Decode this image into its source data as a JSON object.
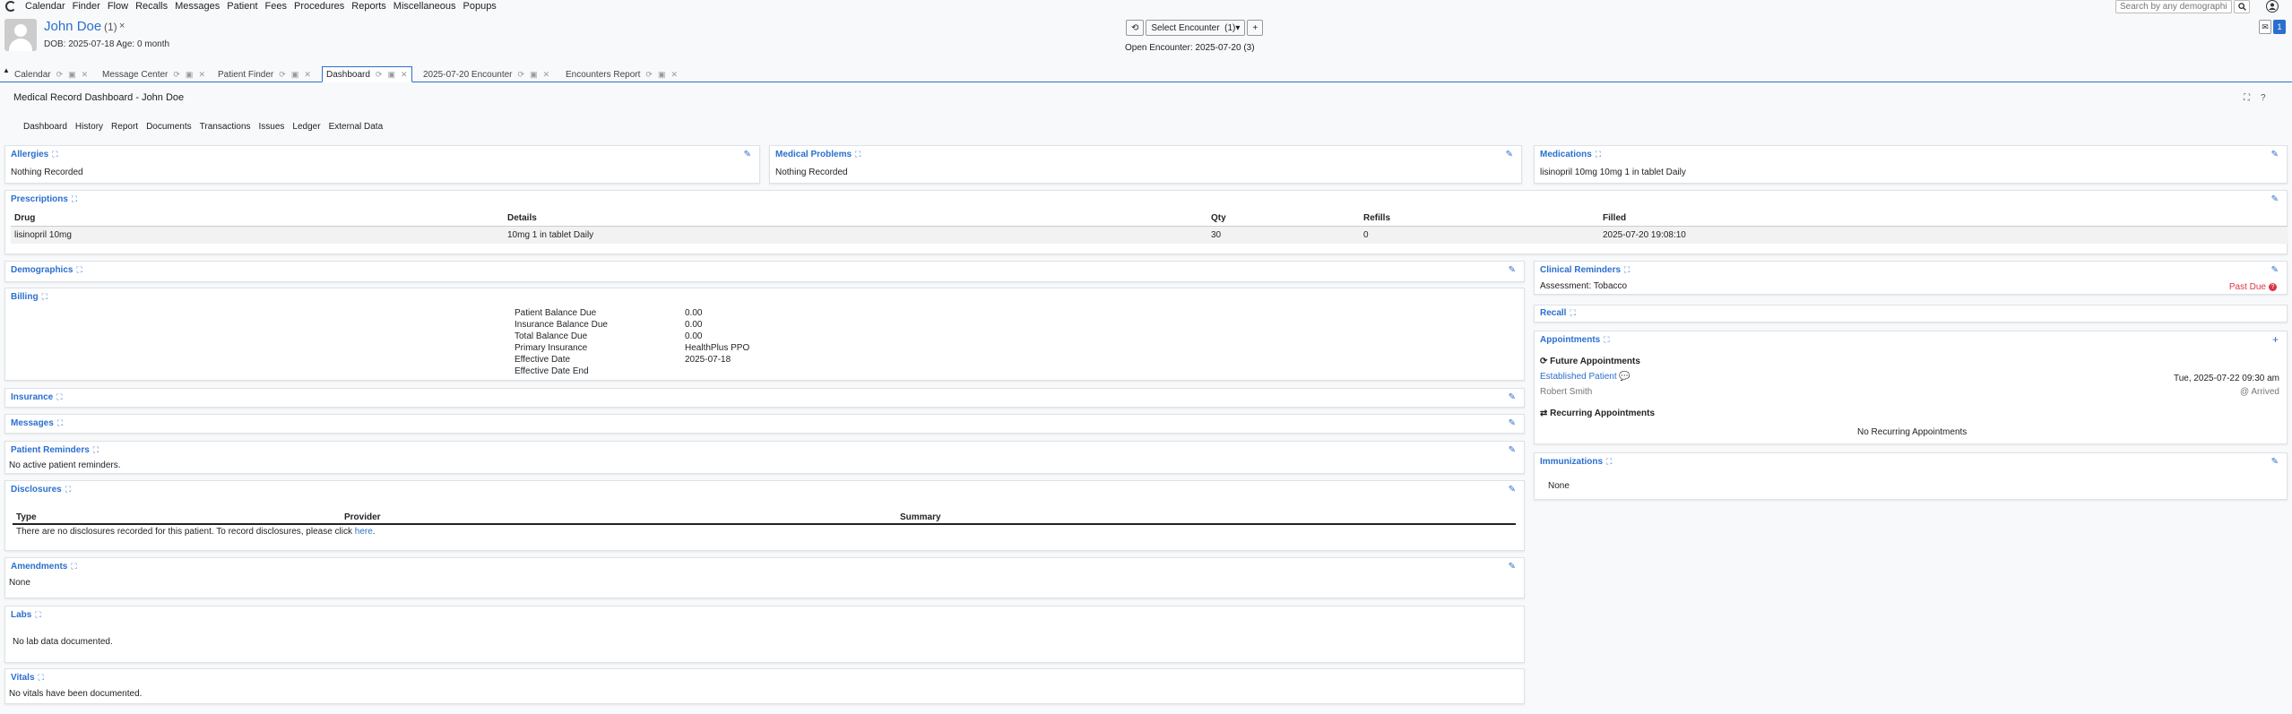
{
  "menu": [
    "Calendar",
    "Finder",
    "Flow",
    "Recalls",
    "Messages",
    "Patient",
    "Fees",
    "Procedures",
    "Reports",
    "Miscellaneous",
    "Popups"
  ],
  "search": {
    "placeholder": "Search by any demographic"
  },
  "patient": {
    "name": "John Doe",
    "count": "(1)",
    "close": "×",
    "dob_age": "DOB: 2025-07-18 Age: 0 month"
  },
  "encounter": {
    "select_label": "Select Encounter",
    "count": "(1)",
    "caret": "▾",
    "add": "+",
    "history": "⟲",
    "open": "Open Encounter: 2025-07-20 (3)"
  },
  "messages": {
    "mail": "✉",
    "count": "1"
  },
  "tabs": [
    {
      "label": "Calendar"
    },
    {
      "label": "Message Center"
    },
    {
      "label": "Patient Finder"
    },
    {
      "label": "Dashboard"
    },
    {
      "label": "2025-07-20 Encounter"
    },
    {
      "label": "Encounters Report"
    }
  ],
  "page_title": "Medical Record Dashboard - John Doe",
  "subnav": [
    "Dashboard",
    "History",
    "Report",
    "Documents",
    "Transactions",
    "Issues",
    "Ledger",
    "External Data"
  ],
  "allergies": {
    "title": "Allergies",
    "text": "Nothing Recorded"
  },
  "medical_problems": {
    "title": "Medical Problems",
    "text": "Nothing Recorded"
  },
  "medications": {
    "title": "Medications",
    "text": "lisinopril 10mg 10mg 1 in tablet Daily"
  },
  "prescriptions": {
    "title": "Prescriptions",
    "headers": [
      "Drug",
      "Details",
      "Qty",
      "Refills",
      "Filled"
    ],
    "rows": [
      [
        "lisinopril 10mg",
        "10mg  1 in tablet Daily",
        "30",
        "0",
        "2025-07-20 19:08:10"
      ]
    ]
  },
  "demographics": {
    "title": "Demographics"
  },
  "billing": {
    "title": "Billing",
    "rows": [
      [
        "Patient Balance Due",
        "0.00"
      ],
      [
        "Insurance Balance Due",
        "0.00"
      ],
      [
        "Total Balance Due",
        "0.00"
      ],
      [
        "Primary Insurance",
        "HealthPlus PPO"
      ],
      [
        "Effective Date",
        "2025-07-18"
      ],
      [
        "Effective Date End",
        ""
      ]
    ]
  },
  "insurance": {
    "title": "Insurance"
  },
  "messages_card": {
    "title": "Messages"
  },
  "patient_reminders": {
    "title": "Patient Reminders",
    "text": "No active patient reminders."
  },
  "disclosures": {
    "title": "Disclosures",
    "headers": [
      "Type",
      "Provider",
      "Summary"
    ],
    "text": "There are no disclosures recorded for this patient. To record disclosures, please click",
    "link": "here",
    "end": "."
  },
  "amendments": {
    "title": "Amendments",
    "text": "None"
  },
  "labs": {
    "title": "Labs",
    "text": "No lab data documented."
  },
  "vitals": {
    "title": "Vitals",
    "text": "No vitals have been documented."
  },
  "clinical_reminders": {
    "title": "Clinical Reminders",
    "item": "Assessment: Tobacco",
    "status": "Past Due"
  },
  "recall": {
    "title": "Recall"
  },
  "appointments": {
    "title": "Appointments",
    "future_label": "Future Appointments",
    "appt_type": "Established Patient",
    "appt_datetime": "Tue,  2025-07-22 09:30 am",
    "provider": "Robert Smith",
    "status": "@ Arrived",
    "recurring_label": "Recurring Appointments",
    "recurring_text": "No Recurring Appointments"
  },
  "immunizations": {
    "title": "Immunizations",
    "text": "None"
  },
  "colors": {
    "accent": "#2a6fcf",
    "danger": "#dc3545"
  }
}
